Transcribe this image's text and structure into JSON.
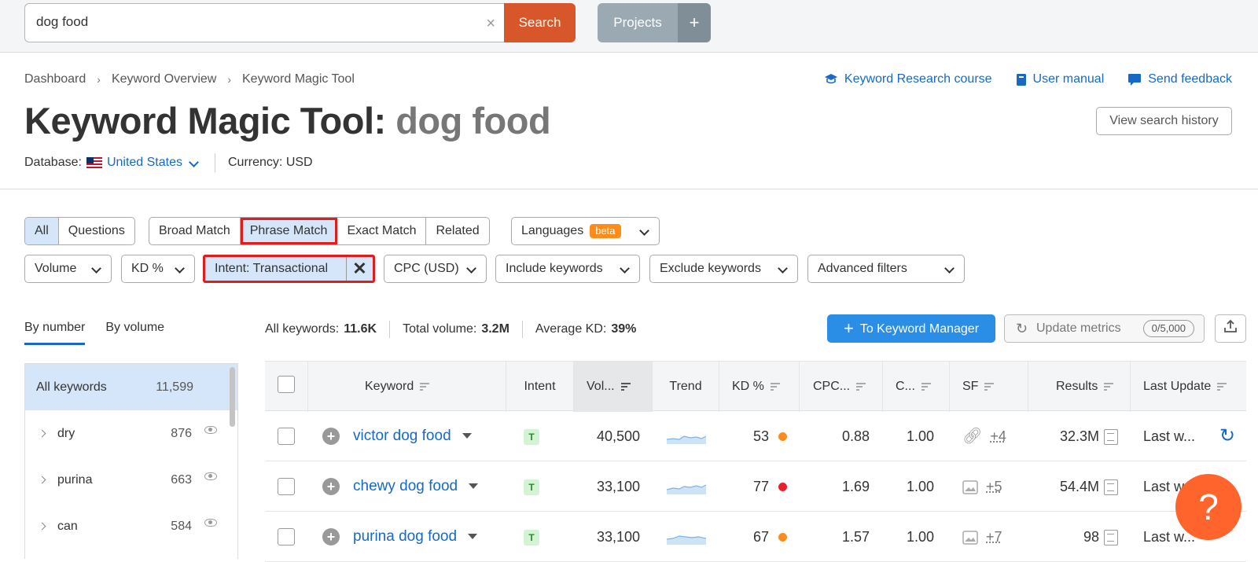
{
  "search": {
    "value": "dog food",
    "clear_label": "×",
    "button_label": "Search"
  },
  "projects": {
    "label": "Projects",
    "plus": "+"
  },
  "breadcrumb": [
    "Dashboard",
    "Keyword Overview",
    "Keyword Magic Tool"
  ],
  "top_links": [
    "Keyword Research course",
    "User manual",
    "Send feedback"
  ],
  "title": {
    "prefix": "Keyword Magic Tool:",
    "query": "dog food"
  },
  "history_button": "View search history",
  "database": {
    "label": "Database:",
    "country": "United States",
    "currency_label": "Currency:",
    "currency": "USD"
  },
  "match_tabs": [
    {
      "label": "All",
      "active": true
    },
    {
      "label": "Questions",
      "active": false
    }
  ],
  "match_types": [
    "Broad Match",
    "Phrase Match",
    "Exact Match",
    "Related"
  ],
  "languages": {
    "label": "Languages",
    "badge": "beta"
  },
  "filters": {
    "volume": "Volume",
    "kd": "KD %",
    "intent": "Intent: Transactional",
    "cpc": "CPC (USD)",
    "include": "Include keywords",
    "exclude": "Exclude keywords",
    "advanced": "Advanced filters"
  },
  "side_tabs": [
    "By number",
    "By volume"
  ],
  "sidebar": {
    "all": {
      "label": "All keywords",
      "count": "11,599"
    },
    "groups": [
      {
        "label": "dry",
        "count": "876"
      },
      {
        "label": "purina",
        "count": "663"
      },
      {
        "label": "can",
        "count": "584"
      }
    ]
  },
  "stats": {
    "all_label": "All keywords:",
    "all_value": "11.6K",
    "volume_label": "Total volume:",
    "volume_value": "3.2M",
    "kd_label": "Average KD:",
    "kd_value": "39%"
  },
  "actions": {
    "keyword_manager": "To Keyword Manager",
    "update_metrics": "Update metrics",
    "quota": "0/5,000"
  },
  "table": {
    "headers": [
      "Keyword",
      "Intent",
      "Vol...",
      "Trend",
      "KD %",
      "CPC...",
      "C...",
      "SF",
      "Results",
      "Last Update"
    ],
    "rows": [
      {
        "keyword": "victor dog food",
        "intent": "T",
        "volume": "40,500",
        "kd": "53",
        "kd_color": "#ff8c1a",
        "cpc": "0.88",
        "com": "1.00",
        "sf_more": "+4",
        "sf_icon": "link-icon",
        "results": "32.3M",
        "last_update": "Last w..."
      },
      {
        "keyword": "chewy dog food",
        "intent": "T",
        "volume": "33,100",
        "kd": "77",
        "kd_color": "#e8202a",
        "cpc": "1.69",
        "com": "1.00",
        "sf_more": "+5",
        "sf_icon": "image-icon",
        "results": "54.4M",
        "last_update": "Last w..."
      },
      {
        "keyword": "purina dog food",
        "intent": "T",
        "volume": "33,100",
        "kd": "67",
        "kd_color": "#ff8c1a",
        "cpc": "1.57",
        "com": "1.00",
        "sf_more": "+7",
        "sf_icon": "image-icon",
        "results": "98",
        "last_update": "Last w..."
      }
    ]
  },
  "help": "?"
}
